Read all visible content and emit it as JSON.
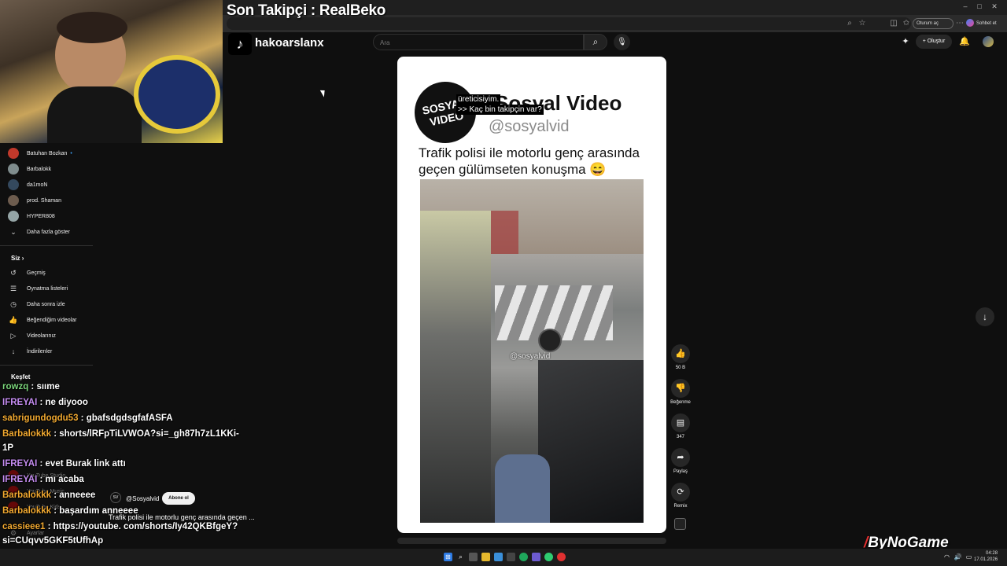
{
  "overlay": {
    "title": "Son Takipçi : RealBeko"
  },
  "browser": {
    "signin_label": "Oturum aç",
    "chat_label": "Sohbet et"
  },
  "header": {
    "channel": "hakoarslanx",
    "search_placeholder": "Ara",
    "create_label": "+ Oluştur"
  },
  "sidebar": {
    "subscriptions": [
      "Batuhan Bozkan",
      "Barbalokk",
      "da1moN",
      "prod. Shaman",
      "HYPER808"
    ],
    "show_more": "Daha fazla göster",
    "you_header": "Siz",
    "you_items": [
      "Geçmiş",
      "Oynatma listeleri",
      "Daha sonra izle",
      "Beğendiğim videolar",
      "Videolarınız",
      "İndirilenler"
    ],
    "explore_header": "Keşfet",
    "faded_items": [
      "YouTube Studio",
      "YouTube Music",
      "YouTube Kids",
      "Ayarlar"
    ]
  },
  "short": {
    "logo_text": "SOSYAL VIDEO",
    "brand_name": "Sosyal Video",
    "brand_handle": "@sosyalvid",
    "post_title": "Trafik polisi ile motorlu genç arasında geçen gülümseten konuşma 😄",
    "watermark": "@sosyalvid",
    "caption_line1": "üreticisiyim.",
    "caption_line2": ">> Kaç bin takipçin var?",
    "channel_handle": "@Sosyalvid",
    "subscribe_label": "Abone ol",
    "title": "Trafik polisi ile motorlu genç arasında geçen ..."
  },
  "actions": {
    "like_count": "50 B",
    "dislike_label": "Beğenme",
    "comment_count": "347",
    "share_label": "Paylaş",
    "remix_label": "Remix"
  },
  "chat": [
    {
      "user": "rowzq",
      "text": " : sııme",
      "color": "#7cd67c"
    },
    {
      "user": "IFREYAI",
      "text": " : ne diyooo",
      "color": "#c48cf0"
    },
    {
      "user": "sabrigundogdu53",
      "text": " : gbafsdgdsgfafASFA",
      "color": "#f0a830"
    },
    {
      "user": "Barbalokkk",
      "text": " : shorts/lRFpTiLVWOA?si=_gh87h7zL1KKi-",
      "color": "#f0a830"
    },
    {
      "user": "",
      "text": "1P",
      "color": "#ffffff"
    },
    {
      "user": "IFREYAI",
      "text": " : evet Burak link attı",
      "color": "#c48cf0"
    },
    {
      "user": "IFREYAI",
      "text": " : mı acaba",
      "color": "#c48cf0"
    },
    {
      "user": "Barbalokkk",
      "text": " : anneeee",
      "color": "#f0a830"
    },
    {
      "user": "Barbalokkk",
      "text": " : başardım anneeee",
      "color": "#f0a830"
    },
    {
      "user": "cassieee1",
      "text": " : https://youtube. com/shorts/Iy42QKBfgeY?",
      "color": "#f0a830"
    },
    {
      "user": "",
      "text": "si=CUqvv5GKF5tUfhAp",
      "color": "#ffffff"
    }
  ],
  "taskbar": {
    "time": "04:28",
    "date": "17.01.2026"
  },
  "brand": {
    "name": "ByNoGame"
  },
  "colors": {
    "background": "#0f0f0f",
    "card": "#ffffff",
    "accent_red": "#ff0000"
  }
}
